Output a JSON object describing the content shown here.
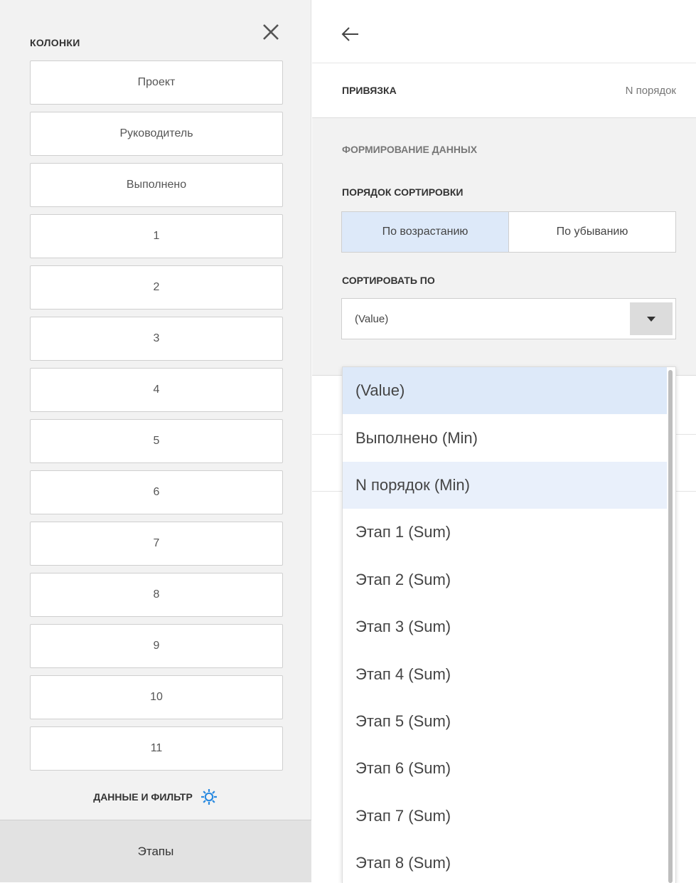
{
  "left_panel": {
    "title": "КОЛОНКИ",
    "columns": [
      "Проект",
      "Руководитель",
      "Выполнено",
      "1",
      "2",
      "3",
      "4",
      "5",
      "6",
      "7",
      "8",
      "9",
      "10",
      "11"
    ],
    "data_filter_label": "ДАННЫЕ И ФИЛЬТР",
    "stages_tab": "Этапы"
  },
  "right_panel": {
    "binding_label": "ПРИВЯЗКА",
    "binding_value": "N порядок",
    "section_title": "ФОРМИРОВАНИЕ ДАННЫХ",
    "sort_order_label": "ПОРЯДОК СОРТИРОВКИ",
    "sort_options": [
      "По возрастанию",
      "По убыванию"
    ],
    "sort_active": "По возрастанию",
    "sort_by_label": "СОРТИРОВАТЬ ПО",
    "sort_by_value": "(Value)"
  },
  "dropdown": {
    "items": [
      "(Value)",
      "Выполнено (Min)",
      "N порядок (Min)",
      "Этап 1 (Sum)",
      "Этап 2 (Sum)",
      "Этап 3 (Sum)",
      "Этап 4 (Sum)",
      "Этап 5 (Sum)",
      "Этап 6 (Sum)",
      "Этап 7 (Sum)",
      "Этап 8 (Sum)"
    ],
    "selected": "(Value)",
    "hovered": "N порядок (Min)"
  },
  "colors": {
    "accent": "#2a8ae0",
    "selected_bg": "#dde9f9"
  },
  "icons": {
    "close": "close-icon",
    "back": "arrow-left-icon",
    "settings": "gear-icon",
    "dropdown": "caret-down-icon"
  }
}
